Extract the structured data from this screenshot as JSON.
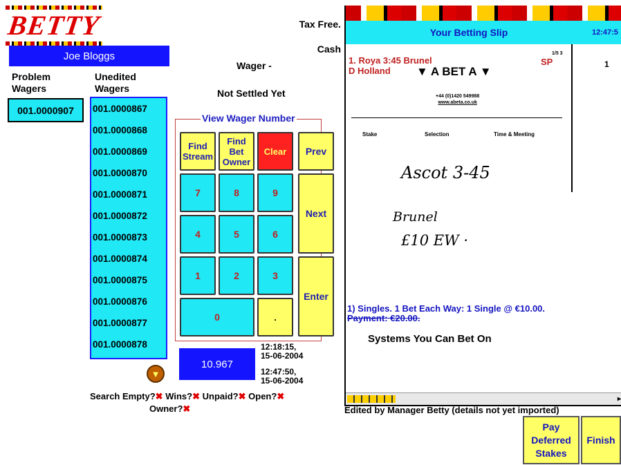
{
  "logo": {
    "text": "BETTY"
  },
  "user": {
    "name": "Joe Bloggs"
  },
  "columns": {
    "problem": "Problem\nWagers",
    "unedited": "Unedited\nWagers"
  },
  "problem_wagers": [
    "001.0000907"
  ],
  "unedited_wagers": [
    "001.0000867",
    "001.0000868",
    "001.0000869",
    "001.0000870",
    "001.0000871",
    "001.0000872",
    "001.0000873",
    "001.0000874",
    "001.0000875",
    "001.0000876",
    "001.0000877",
    "001.0000878"
  ],
  "info": {
    "tax": "Tax Free.",
    "cash": "Cash",
    "wager": "Wager -",
    "status": "Not Settled Yet"
  },
  "keypad": {
    "legend": "View Wager Number",
    "find_stream": "Find Stream",
    "find_owner": "Find Bet Owner",
    "clear": "Clear",
    "prev": "Prev",
    "next": "Next",
    "enter": "Enter",
    "digits": [
      "7",
      "8",
      "9",
      "4",
      "5",
      "6",
      "1",
      "2",
      "3",
      "0",
      "."
    ]
  },
  "counter": "10.967",
  "timestamps": [
    "12:18:15,\n15-06-2004",
    "12:47:50,\n15-06-2004"
  ],
  "filters": {
    "search_empty": "Search Empty?",
    "wins": "Wins?",
    "unpaid": "Unpaid?",
    "open": "Open?",
    "owner": "Owner?",
    "mark": "✖"
  },
  "slip": {
    "title": "Your Betting Slip",
    "time": "12:47:5",
    "line1": "1. Roya 3:45 Brunel",
    "line2": "D Holland",
    "brand": "▼ A BET A ▼",
    "sp": "SP",
    "page": "1/5 3",
    "count": "1",
    "phone": "+44 (0)1420 549988",
    "web": "www.abeta.co.uk",
    "cols": [
      "Stake",
      "Selection",
      "Time & Meeting"
    ],
    "hand1": "Ascot 3-45",
    "hand2": "Brunel",
    "hand3": "£10 EW ·",
    "summary": "1) Singles. 1 Bet Each Way: 1 Single @ €10.00.",
    "payment": "Payment: €20.00.",
    "systems": "Systems You Can Bet On"
  },
  "edited_note": "Edited by Manager Betty (details not yet imported)",
  "buttons": {
    "pay": "Pay Deferred Stakes",
    "finish": "Finish"
  },
  "colors": {
    "cyan": "#20e8f5",
    "blue": "#1414ff",
    "yellow": "#ffff66",
    "red": "#e00000"
  }
}
